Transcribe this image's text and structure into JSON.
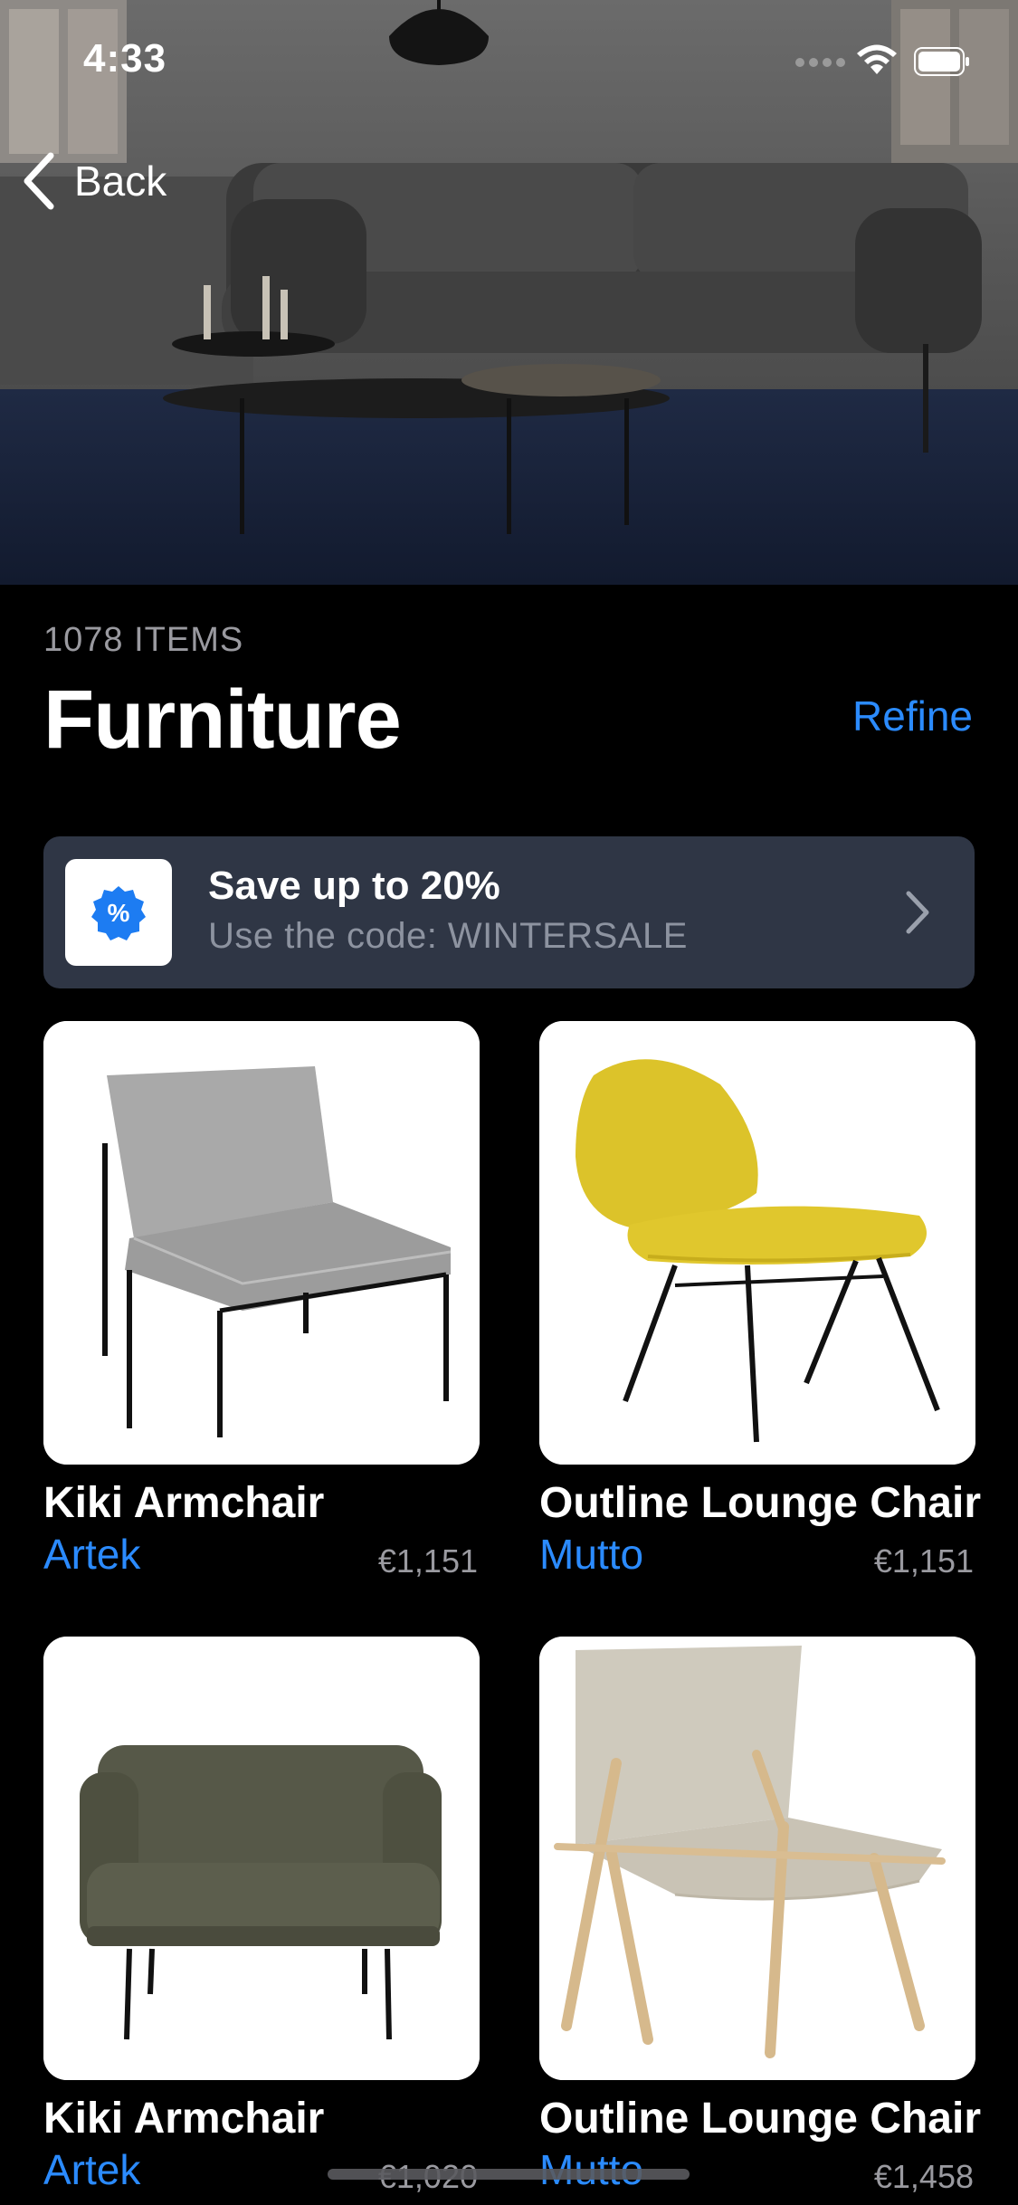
{
  "status_bar": {
    "time": "4:33"
  },
  "nav": {
    "back_label": "Back"
  },
  "header": {
    "items_count": "1078 ITEMS",
    "title": "Furniture",
    "refine_label": "Refine"
  },
  "promo": {
    "title": "Save up to 20%",
    "subtitle": "Use the code: WINTERSALE",
    "icon": "percent-badge-icon"
  },
  "products": [
    {
      "name": "Kiki Armchair",
      "brand": "Artek",
      "price": "€1,151"
    },
    {
      "name": "Outline Lounge Chair",
      "brand": "Mutto",
      "price": "€1,151"
    },
    {
      "name": "Kiki Armchair",
      "brand": "Artek",
      "price": "€1,020"
    },
    {
      "name": "Outline Lounge Chair",
      "brand": "Mutto",
      "price": "€1,458"
    }
  ],
  "colors": {
    "accent": "#2b8bff",
    "banner": "#2f3645",
    "background": "#000000"
  }
}
